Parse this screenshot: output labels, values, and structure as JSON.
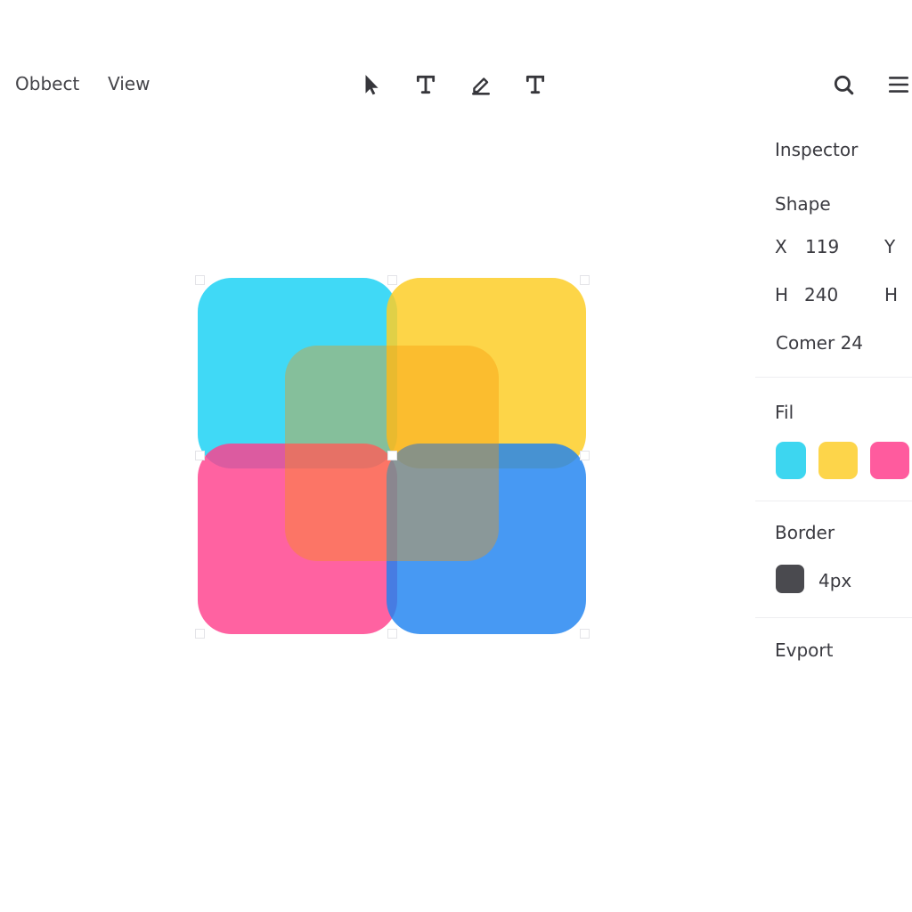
{
  "menu": {
    "object": "Obbect",
    "view": "View"
  },
  "toolbar": {
    "tools": [
      "pointer-tool",
      "text-tool",
      "pen-tool",
      "type-tool"
    ],
    "right": [
      "search-icon",
      "menu-icon"
    ]
  },
  "canvas": {
    "shapes": [
      {
        "name": "cyan",
        "color": "#1ED2F5"
      },
      {
        "name": "yellow",
        "color": "#FDCE28"
      },
      {
        "name": "pink",
        "color": "#FF408C"
      },
      {
        "name": "blue",
        "color": "#1E82F0"
      },
      {
        "name": "center",
        "color": "#F89608"
      }
    ]
  },
  "inspector": {
    "title": "Inspector",
    "shape_heading": "Shape",
    "x_label": "X",
    "x_value": "119",
    "y_label": "Y",
    "h_label": "H",
    "h_value": "240",
    "h2_label": "H",
    "corner": "Comer 24",
    "fill_heading": "Fil",
    "fill_swatches": [
      "#3DD6F0",
      "#FDD54A",
      "#FF5B9E"
    ],
    "border_heading": "Border",
    "border_color": "#4A4A4F",
    "border_width": "4px",
    "export_heading": "Evport"
  }
}
